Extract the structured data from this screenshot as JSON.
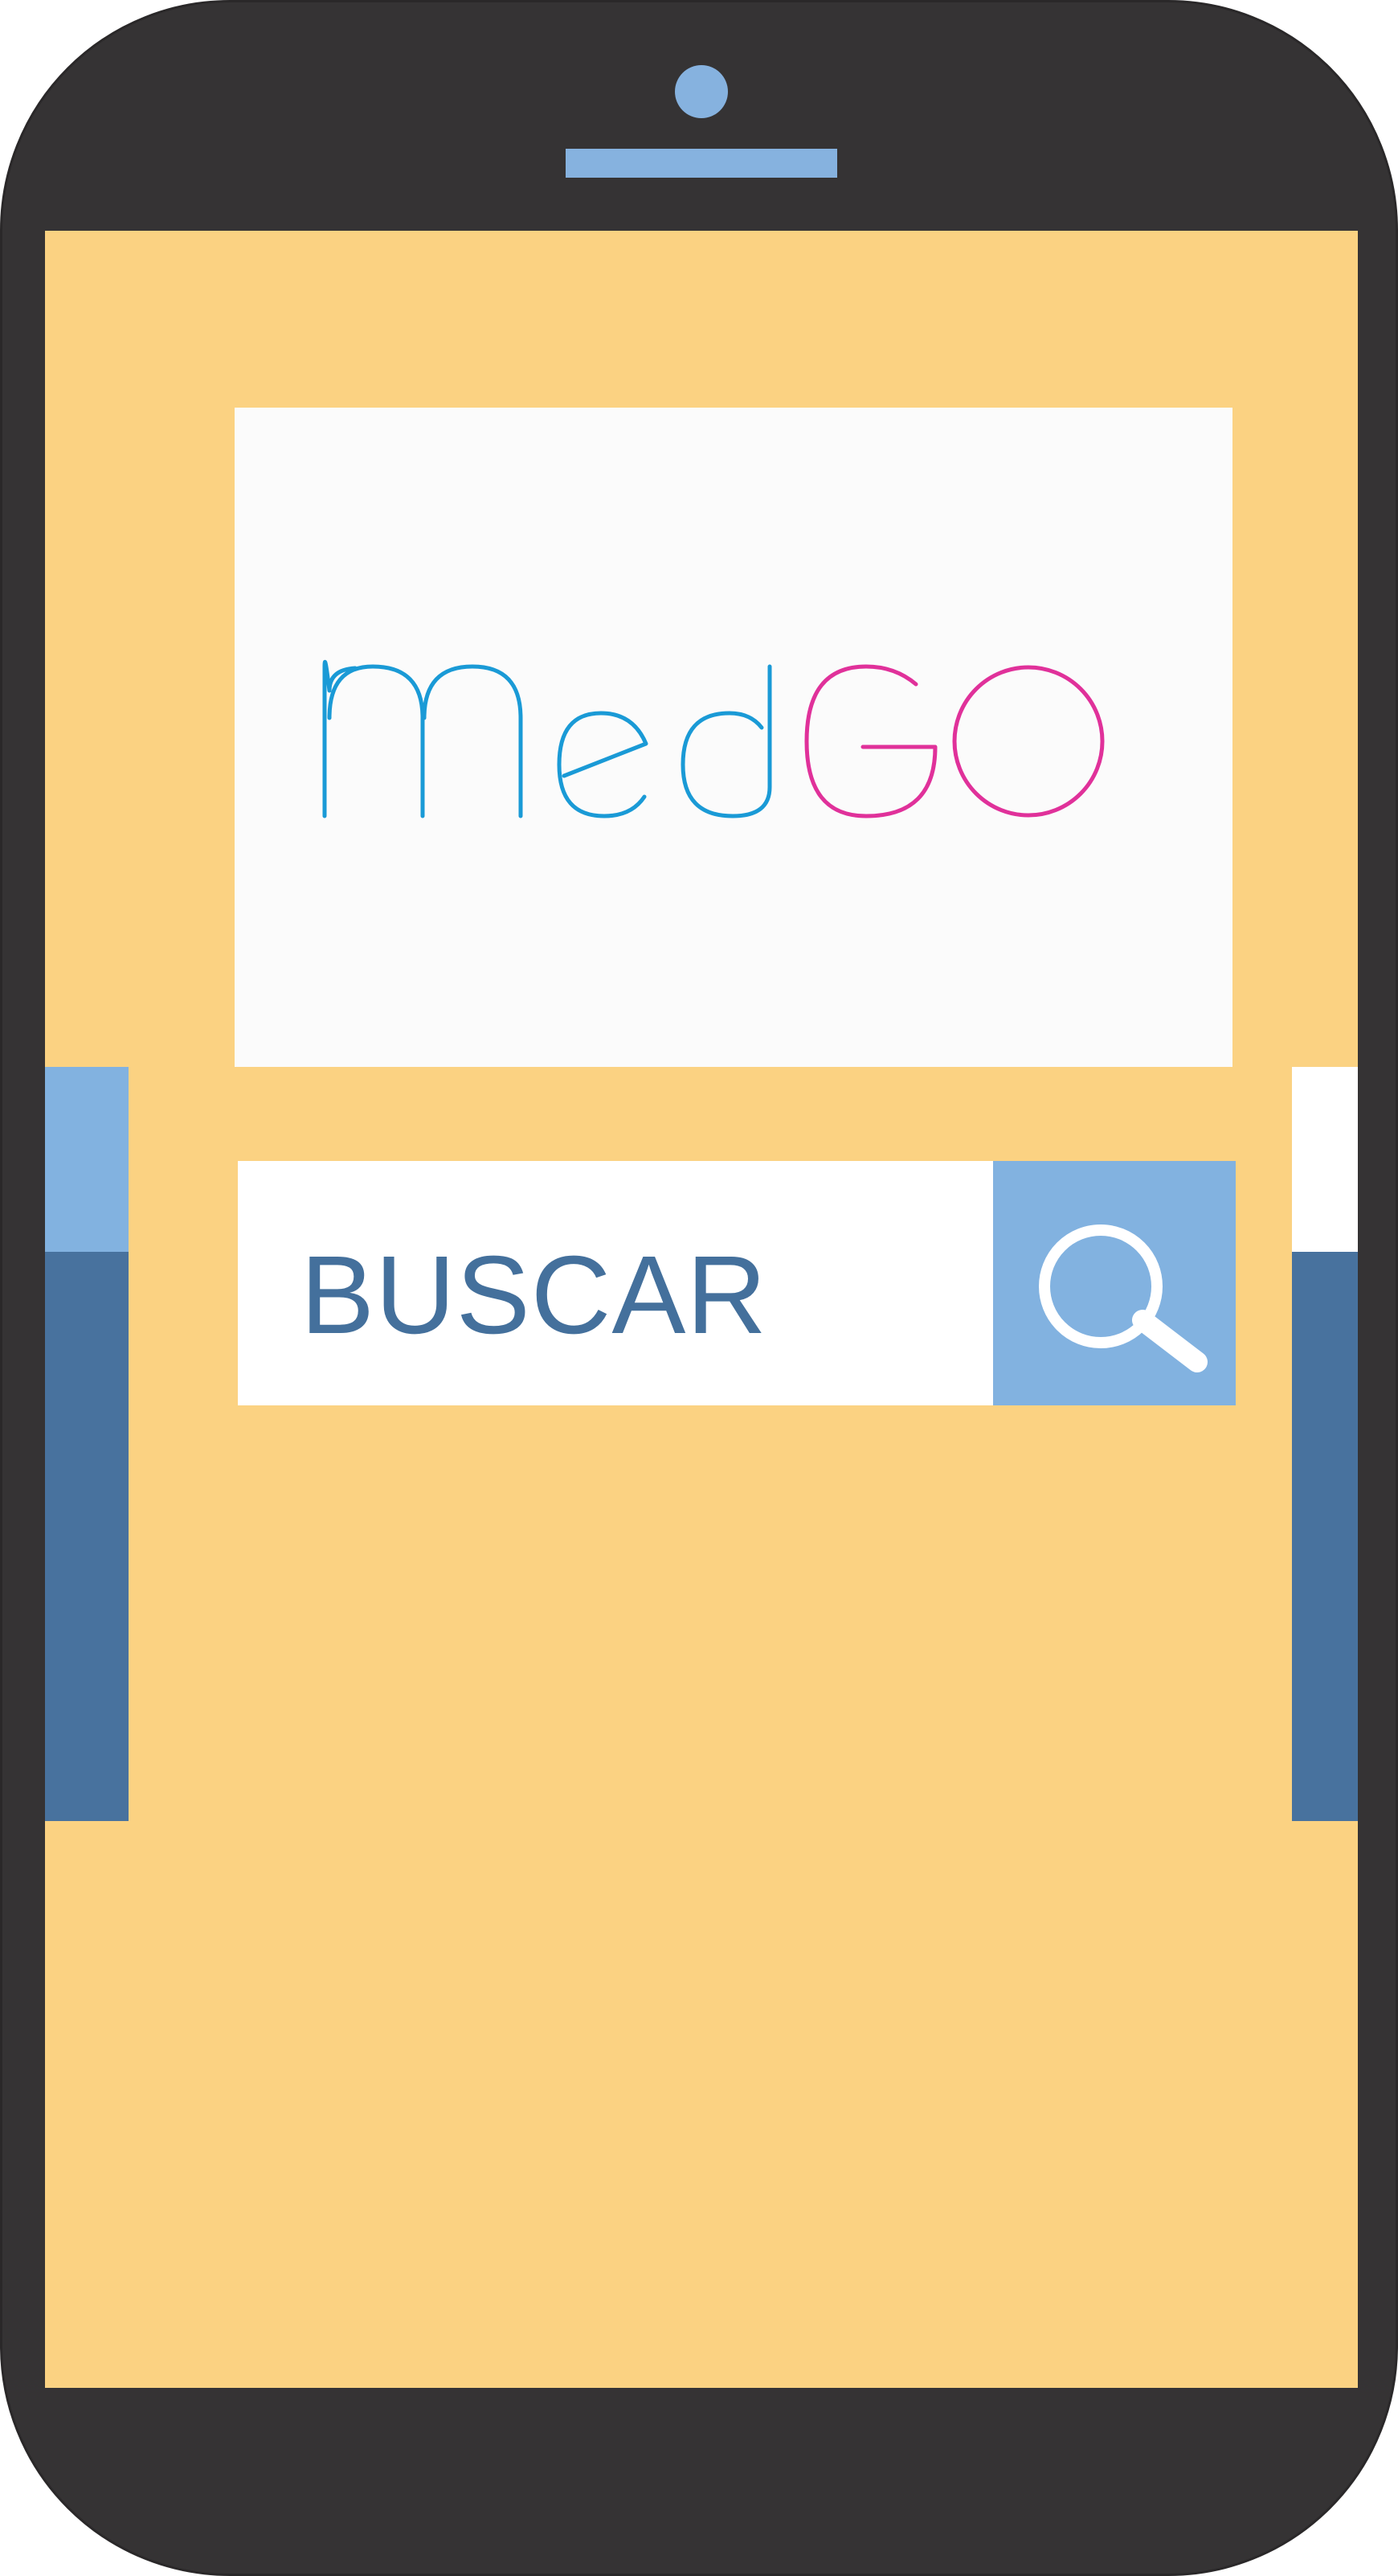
{
  "app": {
    "logo_part_1": "Med",
    "logo_part_2": "GO",
    "logo_colors": {
      "med": "#1a9ad6",
      "go": "#e0319a"
    }
  },
  "search": {
    "label": "BUSCAR",
    "button_icon": "search-icon"
  },
  "colors": {
    "phone_body": "#353334",
    "screen_background": "#fbd282",
    "accent_light_blue": "#82b2e0",
    "accent_dark_blue": "#48729e",
    "text_blue": "#44709c"
  }
}
